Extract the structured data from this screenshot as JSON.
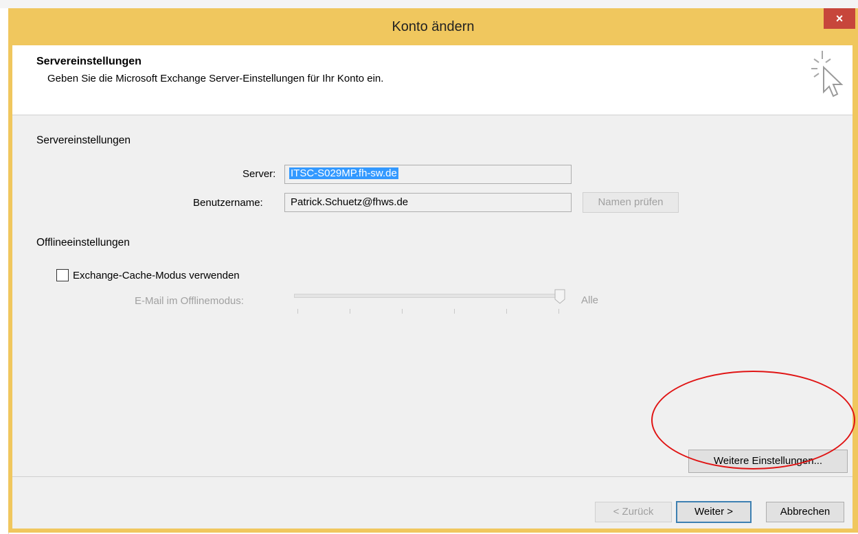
{
  "window": {
    "title": "Konto ändern",
    "close_glyph": "×"
  },
  "header": {
    "title": "Servereinstellungen",
    "subtitle": "Geben Sie die Microsoft Exchange Server-Einstellungen für Ihr Konto ein.",
    "icon": "cursor-click-icon"
  },
  "server_settings": {
    "section_label": "Servereinstellungen",
    "server_label": "Server:",
    "server_value": "ITSC-S029MP.fh-sw.de",
    "username_label": "Benutzername:",
    "username_value": "Patrick.Schuetz@fhws.de",
    "check_name_button": "Namen prüfen"
  },
  "offline_settings": {
    "section_label": "Offlineeinstellungen",
    "cache_checkbox_label": "Exchange-Cache-Modus verwenden",
    "cache_checked": false,
    "slider_label": "E-Mail im Offlinemodus:",
    "slider_value_label": "Alle",
    "slider_fraction": 1.0
  },
  "buttons": {
    "more_settings": "Weitere Einstellungen...",
    "back": "< Zurück",
    "next": "Weiter >",
    "cancel": "Abbrechen"
  },
  "colors": {
    "titlebar": "#f0c75e",
    "close": "#c7463b",
    "selection": "#3399ff",
    "annotation": "#e01414"
  }
}
